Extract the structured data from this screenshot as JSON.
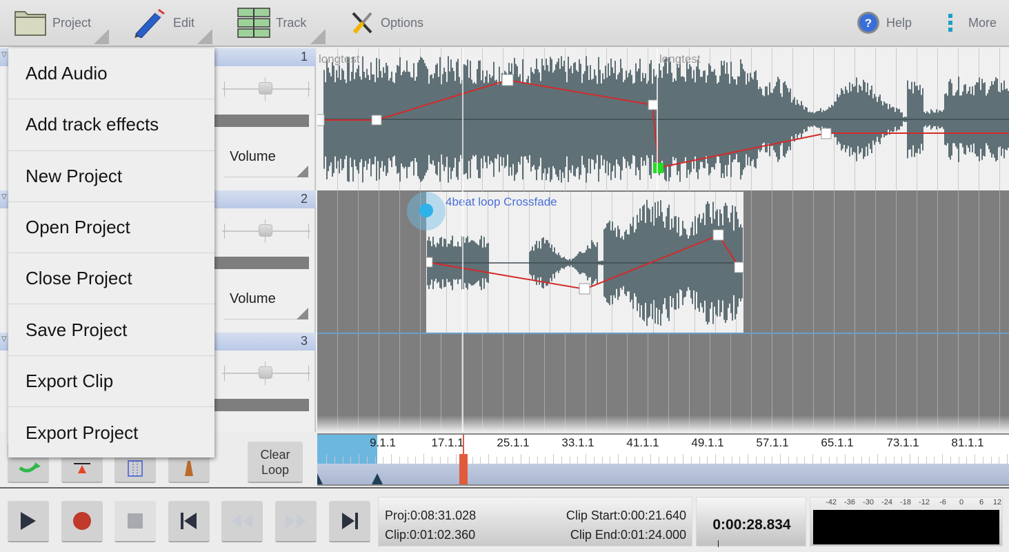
{
  "toolbar": {
    "project": "Project",
    "edit": "Edit",
    "track": "Track",
    "options": "Options",
    "help": "Help",
    "more": "More"
  },
  "project_menu": {
    "items": [
      "Add Audio",
      "Add track effects",
      "New Project",
      "Open Project",
      "Close Project",
      "Save Project",
      "Export Clip",
      "Export Project"
    ]
  },
  "tracks": [
    {
      "number": "1",
      "automation": "Volume",
      "clips": [
        {
          "name": "longtest"
        },
        {
          "name": "longtest"
        }
      ]
    },
    {
      "number": "2",
      "automation": "Volume",
      "clips": [
        {
          "name": "4beat loop Crossfade",
          "selected": true
        }
      ]
    },
    {
      "number": "3"
    }
  ],
  "tools": {
    "clear_loop_line1": "Clear",
    "clear_loop_line2": "Loop"
  },
  "ruler": {
    "labels": [
      "9.1.1",
      "17.1.1",
      "25.1.1",
      "33.1.1",
      "41.1.1",
      "49.1.1",
      "57.1.1",
      "65.1.1",
      "73.1.1",
      "81.1.1"
    ]
  },
  "info": {
    "proj": "Proj:0:08:31.028",
    "clip": "Clip:0:01:02.360",
    "clip_start": "Clip Start:0:00:21.640",
    "clip_end": "Clip End:0:01:24.000"
  },
  "current_time": "0:00:28.834",
  "level_meter": {
    "labels": [
      "-42",
      "-36",
      "-30",
      "-24",
      "-18",
      "-12",
      "-6",
      "0",
      "6",
      "12"
    ]
  },
  "colors": {
    "waveform": "#5f7076",
    "envelope": "#d42a2a",
    "selected_node": "#22dd22",
    "loop_region": "#6bb7e0",
    "playhead_marker": "#e25a3c",
    "clip_label_selected": "#4a6fd8"
  }
}
